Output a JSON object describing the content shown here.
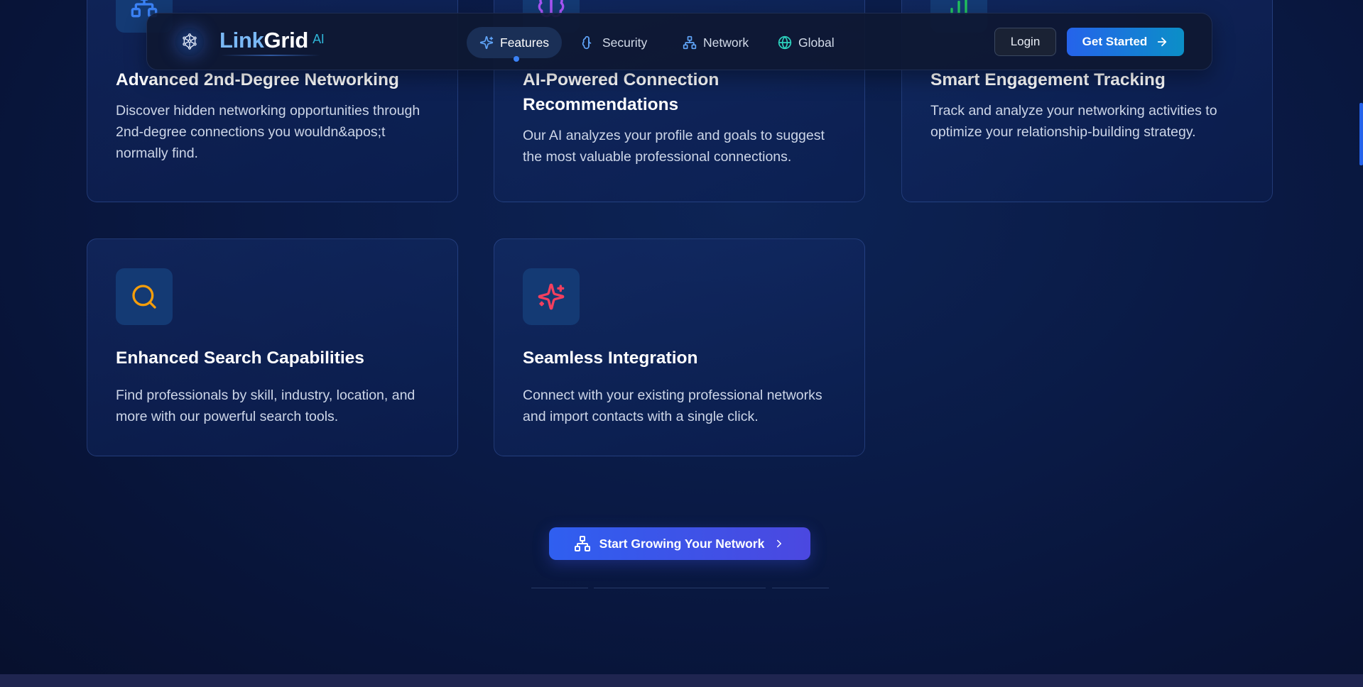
{
  "nav": {
    "brand_part1": "Link",
    "brand_part2": "Grid",
    "brand_suffix": "AI",
    "items": [
      {
        "label": "Features",
        "icon": "sparkles-icon",
        "active": true
      },
      {
        "label": "Security",
        "icon": "brain-icon",
        "active": false
      },
      {
        "label": "Network",
        "icon": "network-icon",
        "active": false
      },
      {
        "label": "Global",
        "icon": "globe-icon",
        "active": false
      }
    ],
    "login_label": "Login",
    "get_started_label": "Get Started"
  },
  "features": [
    {
      "title": "Advanced 2nd-Degree Networking",
      "description": "Discover hidden networking opportunities through 2nd-degree connections you wouldn&apos;t normally find.",
      "icon": "network-icon",
      "color": "#3b82f6"
    },
    {
      "title": "AI-Powered Connection Recommendations",
      "description": "Our AI analyzes your profile and goals to suggest the most valuable professional connections.",
      "icon": "brain-icon",
      "color": "#a855f7"
    },
    {
      "title": "Smart Engagement Tracking",
      "description": "Track and analyze your networking activities to optimize your relationship-building strategy.",
      "icon": "bar-chart-icon",
      "color": "#22c55e"
    },
    {
      "title": "Enhanced Search Capabilities",
      "description": "Find professionals by skill, industry, location, and more with our powerful search tools.",
      "icon": "search-icon",
      "color": "#f59e0b"
    },
    {
      "title": "Seamless Integration",
      "description": "Connect with your existing professional networks and import contacts with a single click.",
      "icon": "sparkles-icon",
      "color": "#f43f5e"
    }
  ],
  "cta": {
    "label": "Start Growing Your Network",
    "icon": "network-icon"
  }
}
